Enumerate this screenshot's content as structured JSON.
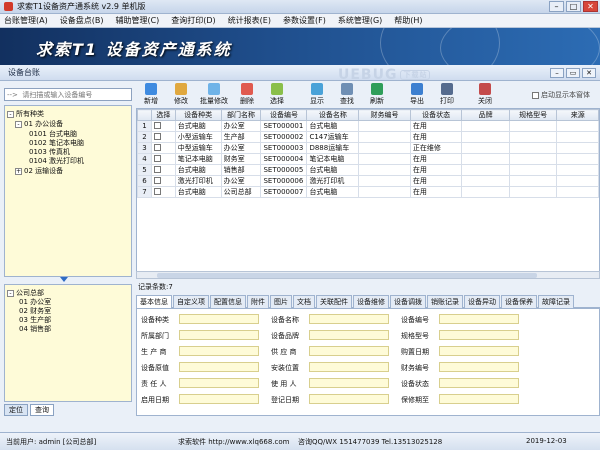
{
  "window": {
    "title": "求索T1设备资产通系统 v2.9 单机版"
  },
  "menu": [
    "台账管理(A)",
    "设备盘点(B)",
    "辅助管理(C)",
    "查询打印(D)",
    "统计报表(E)",
    "参数设置(F)",
    "系统管理(G)",
    "帮助(H)"
  ],
  "banner": {
    "title": "求索T1 设备资产通系统"
  },
  "panel": {
    "title": "设备台账",
    "watermark": "UEBUG",
    "watermark_badge": "下载站"
  },
  "search": {
    "placeholder": "-->  请扫描或输入设备编号"
  },
  "tree1": {
    "items": [
      "所有种类",
      "01 办公设备",
      "0101 台式电脑",
      "0102 笔记本电脑",
      "0103 传真机",
      "0104 激光打印机",
      "02 运输设备"
    ]
  },
  "tree2": {
    "items": [
      "公司总部",
      "01 办公室",
      "02 财务室",
      "03 生产部",
      "04 销售部"
    ]
  },
  "left_tabs": [
    "定位",
    "查询"
  ],
  "toolbar": [
    "新增",
    "修改",
    "批量修改",
    "删除",
    "选择",
    "显示",
    "查找",
    "刷新",
    "导出",
    "打印",
    "关闭"
  ],
  "autoshow": "启动显示本窗体",
  "table": {
    "headers": [
      "",
      "选择",
      "设备种类",
      "部门名称",
      "设备编号",
      "设备名称",
      "财务编号",
      "设备状态",
      "品牌",
      "规格型号",
      "来源"
    ],
    "rows": [
      [
        "1",
        "",
        "台式电脑",
        "办公室",
        "SET000001",
        "台式电脑",
        "",
        "在用",
        "",
        "",
        ""
      ],
      [
        "2",
        "",
        "小型运输车",
        "生产部",
        "SET000002",
        "C147运输车",
        "",
        "在用",
        "",
        "",
        ""
      ],
      [
        "3",
        "",
        "中型运输车",
        "办公室",
        "SET000003",
        "D888运输车",
        "",
        "正在维修",
        "",
        "",
        ""
      ],
      [
        "4",
        "",
        "笔记本电脑",
        "财务室",
        "SET000004",
        "笔记本电脑",
        "",
        "在用",
        "",
        "",
        ""
      ],
      [
        "5",
        "",
        "台式电脑",
        "销售部",
        "SET000005",
        "台式电脑",
        "",
        "在用",
        "",
        "",
        ""
      ],
      [
        "6",
        "",
        "激光打印机",
        "办公室",
        "SET000006",
        "激光打印机",
        "",
        "在用",
        "",
        "",
        ""
      ],
      [
        "7",
        "",
        "台式电脑",
        "公司总部",
        "SET000007",
        "台式电脑",
        "",
        "在用",
        "",
        "",
        ""
      ]
    ]
  },
  "record_count": "记录条数:7",
  "detail_tabs": [
    "基本信息",
    "自定义项",
    "配置信息",
    "附件",
    "图片",
    "文档",
    "关联配件",
    "设备维修",
    "设备调拨",
    "销账记录",
    "设备异动",
    "设备保养",
    "故障记录"
  ],
  "form": {
    "col1": [
      "设备种类",
      "所属部门",
      "生 产 商",
      "设备原值",
      "责 任 人",
      "启用日期"
    ],
    "col2": [
      "设备名称",
      "设备品牌",
      "供 应 商",
      "安装位置",
      "使 用 人",
      "登记日期"
    ],
    "col3": [
      "设备编号",
      "规格型号",
      "购置日期",
      "财务编号",
      "设备状态",
      "保修期至"
    ]
  },
  "status": {
    "user": "当前用户: admin [公司总部]",
    "company": "求索软件  http://www.xlq668.com",
    "contact": "咨询QQ/WX 151477039     Tel.13513025128",
    "date": "2019-12-03"
  }
}
